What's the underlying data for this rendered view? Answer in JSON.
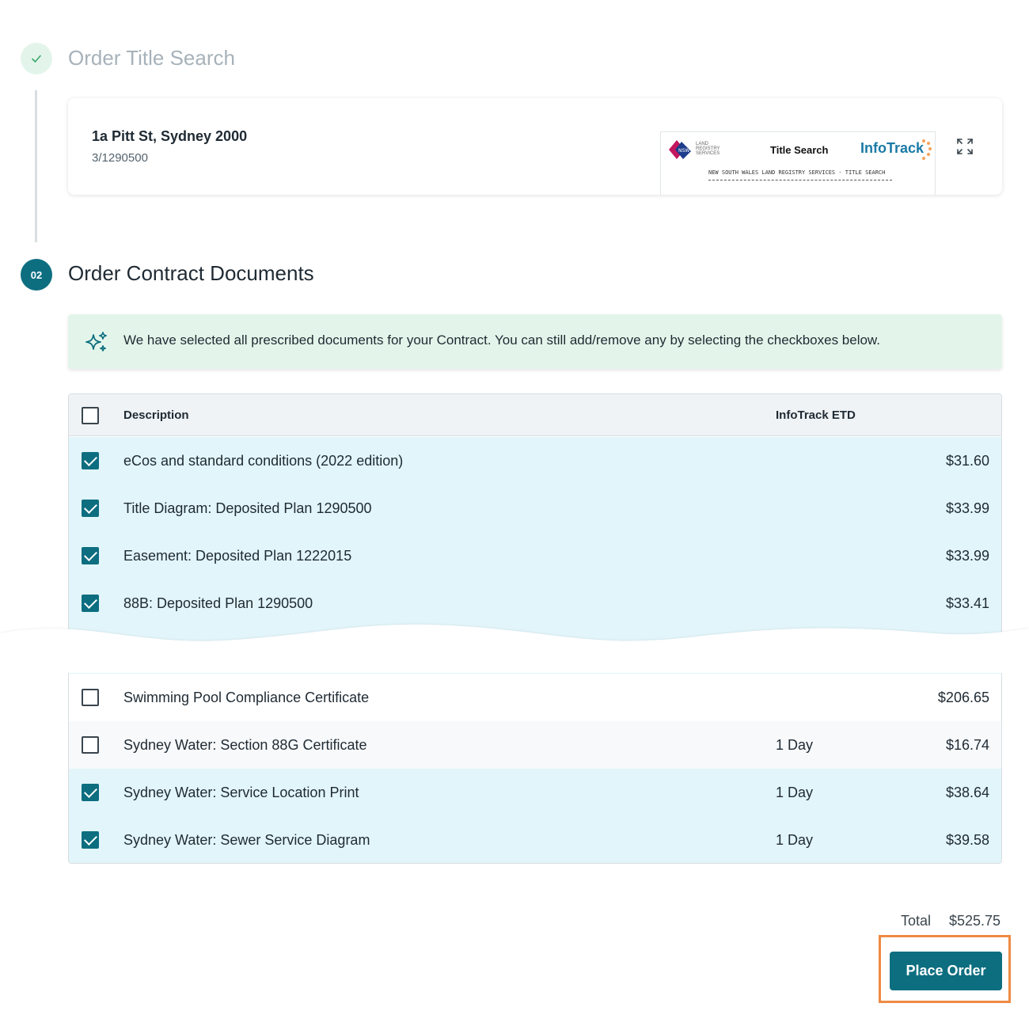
{
  "step1": {
    "title": "Order Title Search",
    "status": "complete"
  },
  "title_card": {
    "address": "1a Pitt St, Sydney 2000",
    "folio": "3/1290500",
    "thumbnail": {
      "title": "Title Search",
      "brand": "InfoTrack",
      "nsw_text": "LAND REGISTRY SERVICES",
      "nsw_badge": "NSW",
      "subtitle": "NEW SOUTH WALES LAND REGISTRY SERVICES - TITLE SEARCH"
    },
    "expand_icon": "expand-icon"
  },
  "step2": {
    "number": "02",
    "title": "Order Contract Documents"
  },
  "banner": {
    "icon": "sparkle-icon",
    "text": "We have selected all prescribed documents for your Contract. You can still add/remove any by selecting the checkboxes below."
  },
  "table": {
    "headers": {
      "description": "Description",
      "etd": "InfoTrack ETD"
    },
    "rows_top": [
      {
        "checked": true,
        "description": "eCos and standard conditions (2022 edition)",
        "etd": "",
        "price": "$31.60"
      },
      {
        "checked": true,
        "description": "Title Diagram: Deposited Plan 1290500",
        "etd": "",
        "price": "$33.99"
      },
      {
        "checked": true,
        "description": "Easement: Deposited Plan 1222015",
        "etd": "",
        "price": "$33.99"
      },
      {
        "checked": true,
        "description": "88B: Deposited Plan 1290500",
        "etd": "",
        "price": "$33.41"
      }
    ],
    "rows_bottom": [
      {
        "checked": false,
        "description": "Swimming Pool Compliance Certificate",
        "etd": "",
        "price": "$206.65"
      },
      {
        "checked": false,
        "description": "Sydney Water: Section 88G Certificate",
        "etd": "1 Day",
        "price": "$16.74"
      },
      {
        "checked": true,
        "description": "Sydney Water: Service Location Print",
        "etd": "1 Day",
        "price": "$38.64"
      },
      {
        "checked": true,
        "description": "Sydney Water: Sewer Service Diagram",
        "etd": "1 Day",
        "price": "$39.58"
      }
    ]
  },
  "total": {
    "label": "Total",
    "value": "$525.75"
  },
  "place_order_label": "Place Order",
  "colors": {
    "primary": "#0d6e80",
    "highlight": "#ef8a43",
    "banner_bg": "#e3f5ea",
    "checked_row_bg": "#e2f5fa"
  }
}
